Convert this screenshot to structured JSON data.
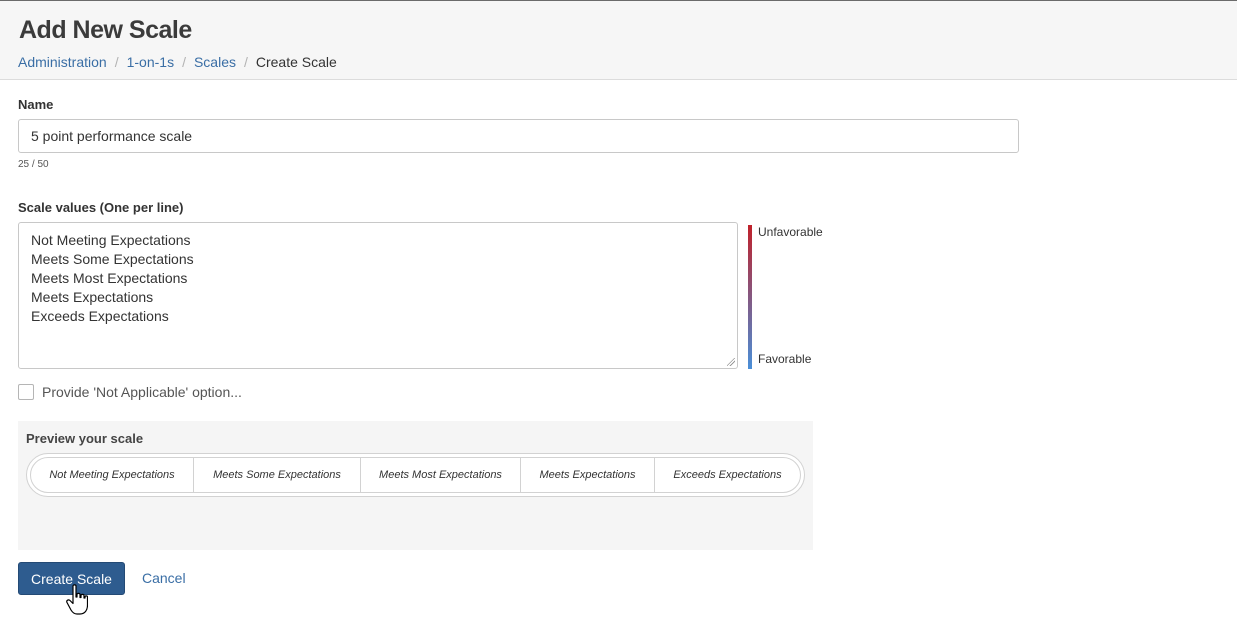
{
  "header": {
    "title": "Add New Scale",
    "breadcrumb": [
      {
        "label": "Administration",
        "link": true
      },
      {
        "label": "1-on-1s",
        "link": true
      },
      {
        "label": "Scales",
        "link": true
      },
      {
        "label": "Create Scale",
        "link": false
      }
    ],
    "separator": "/"
  },
  "form": {
    "name_label": "Name",
    "name_value": "5 point performance scale",
    "char_count": "25 / 50",
    "values_label": "Scale values (One per line)",
    "values": [
      "Not Meeting Expectations",
      "Meets Some Expectations",
      "Meets Most Expectations",
      "Meets Expectations",
      "Exceeds Expectations"
    ],
    "gradient": {
      "top_label": "Unfavorable",
      "bottom_label": "Favorable",
      "top_color": "#c0212a",
      "bottom_color": "#4a8fd8"
    },
    "na_checkbox_label": "Provide 'Not Applicable' option...",
    "na_checked": false
  },
  "preview": {
    "title": "Preview your scale",
    "items": [
      "Not Meeting Expectations",
      "Meets Some Expectations",
      "Meets Most Expectations",
      "Meets Expectations",
      "Exceeds Expectations"
    ]
  },
  "actions": {
    "create_label": "Create Scale",
    "cancel_label": "Cancel",
    "primary_color": "#2e5c8f",
    "link_color": "#3a6ea5"
  },
  "icons": {
    "cursor": "hand-pointer-cursor-icon"
  }
}
